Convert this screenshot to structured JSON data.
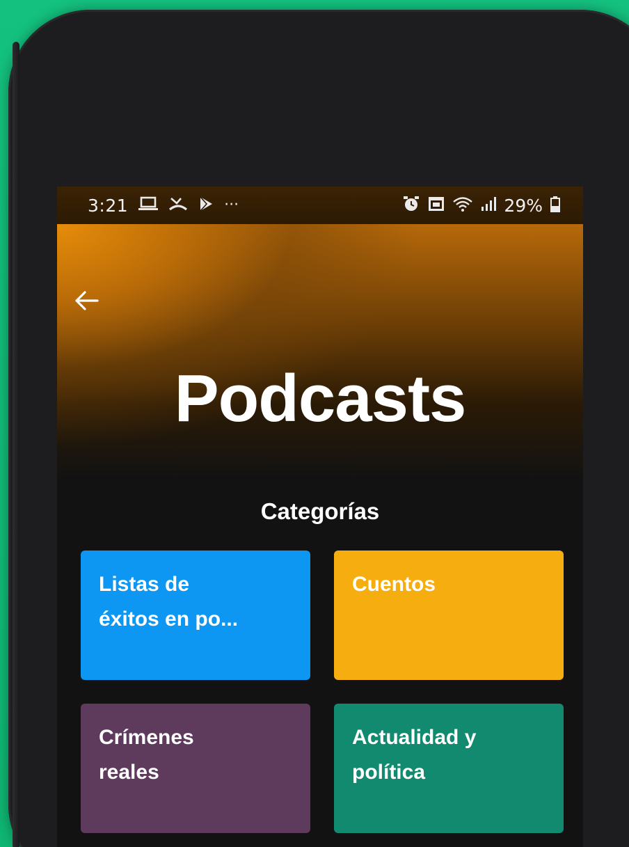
{
  "status_bar": {
    "time": "3:21",
    "left_icons": [
      "laptop-icon",
      "missed-call-icon",
      "play-store-icon",
      "more-dots-icon"
    ],
    "more": "···",
    "right_icons": [
      "alarm-icon",
      "calendar-icon",
      "wifi-icon",
      "signal-icon",
      "battery-icon"
    ],
    "battery": "29%"
  },
  "header": {
    "title": "Podcasts",
    "gradient_color": "#c27408"
  },
  "section": {
    "title": "Categorías"
  },
  "categories": [
    {
      "line1": "Listas de",
      "line2": "éxitos en po...",
      "color": "#0d96f2"
    },
    {
      "line1": "Cuentos",
      "line2": "",
      "color": "#f5ad0f"
    },
    {
      "line1": "Crímenes",
      "line2": "reales",
      "color": "#5e3a5c"
    },
    {
      "line1": "Actualidad y",
      "line2": "política",
      "color": "#118a6f"
    }
  ],
  "colors": {
    "background_green": "#14c17f",
    "phone_body": "#1d1d1f",
    "screen_bg": "#121212"
  }
}
